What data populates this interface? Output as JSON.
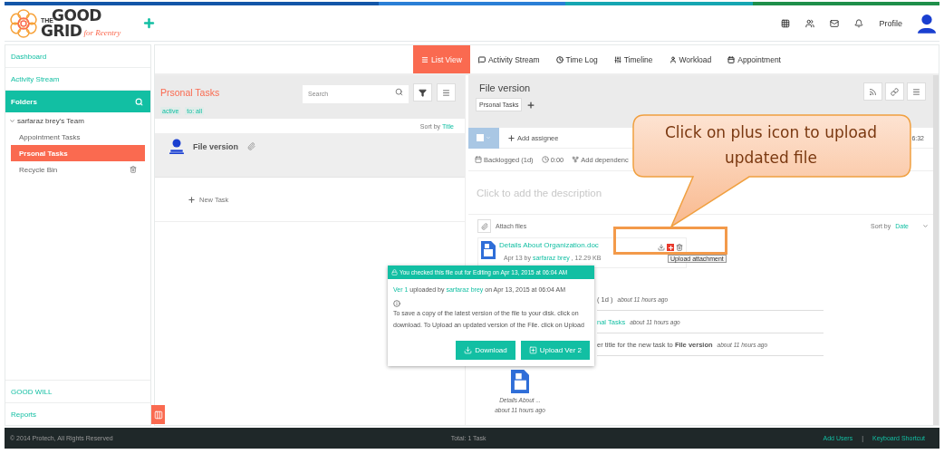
{
  "header": {
    "logo": {
      "the": "THE",
      "good": "GOOD",
      "grid": "GRID",
      "tagline": "for Reentry"
    },
    "profile": "Profile"
  },
  "sidebar": {
    "links": [
      {
        "label": "Dashboard"
      },
      {
        "label": "Activity Stream"
      }
    ],
    "folders": {
      "label": "Folders"
    },
    "tree": [
      {
        "label": "sarfaraz brey's Team",
        "expanded": true,
        "children": [
          {
            "label": "Appointment Tasks",
            "selected": false
          },
          {
            "label": "Prsonal Tasks",
            "selected": true
          },
          {
            "label": "Recycle Bin",
            "selected": false,
            "kind": "trash"
          }
        ]
      }
    ],
    "bottom": [
      {
        "label": "GOOD WILL"
      },
      {
        "label": "Reports"
      }
    ]
  },
  "tabs": [
    {
      "label": "List View",
      "selected": true
    },
    {
      "label": "Activity Stream",
      "selected": false
    },
    {
      "label": "Time Log",
      "selected": false
    },
    {
      "label": "Timeline",
      "selected": false
    },
    {
      "label": "Workload",
      "selected": false
    },
    {
      "label": "Appointment",
      "selected": false
    }
  ],
  "task_list": {
    "title": "Prsonal Tasks",
    "filters": [
      "active",
      "to: all"
    ],
    "search": {
      "placeholder": "Search"
    },
    "sort_label": "Sort by",
    "sort_value": "Title",
    "tasks": [
      {
        "title": "File version",
        "selected": true
      }
    ],
    "new_task": "New Task"
  },
  "detail": {
    "title": "File version",
    "tag": "Prsonal Tasks",
    "select_all": {
      "checked": false
    },
    "add_assignee": "Add assignee",
    "time": "6:32",
    "status": "Backlogged (1d)",
    "timer": "0:00",
    "dependency": "Add dependenc",
    "description": "Click to add the description",
    "attach": "Attach files",
    "sort_label": "Sort by",
    "sort_value": "Date",
    "attachment": {
      "name": "Details About Organization.doc",
      "date": "Apr 13 by",
      "user": "sarfaraz brey",
      "size": ", 12.29 KB"
    },
    "tooltip": "Upload attachment",
    "activity": [
      {
        "text": "( 1d )",
        "time": "about 11 hours ago",
        "kind": "text"
      },
      {
        "text": "nal Tasks",
        "time": "about 11 hours ago",
        "kind": "link"
      },
      {
        "text": "er title for the new task to **File version**",
        "time": "about 11 hours ago",
        "kind": "text"
      }
    ],
    "thumb": {
      "name": "Details About ...",
      "time": "about 11 hours ago"
    }
  },
  "popup": {
    "title": "You checked this file out for Editing on Apr 13, 2015 at 06:04 AM",
    "version": "Ver 1",
    "uploaded_by": "uploaded by",
    "user": "sarfaraz brey",
    "uploaded_on": "on Apr 13, 2015 at 06:04 AM",
    "message": "To save a copy of the latest version of the file to your disk. click on download. To Upload an updated version of the File. click on Upload",
    "buttons": [
      {
        "label": "Download",
        "kind": "download"
      },
      {
        "label": "Upload Ver 2",
        "kind": "upload"
      }
    ]
  },
  "callout": {
    "text": "Click on plus icon to upload updated file"
  },
  "footer": {
    "copyright": "© 2014 Protech, All Rights Reserved",
    "total": "Total: 1 Task",
    "links": [
      "Add Users",
      "Keyboard Shortcut"
    ],
    "separator": "|"
  }
}
